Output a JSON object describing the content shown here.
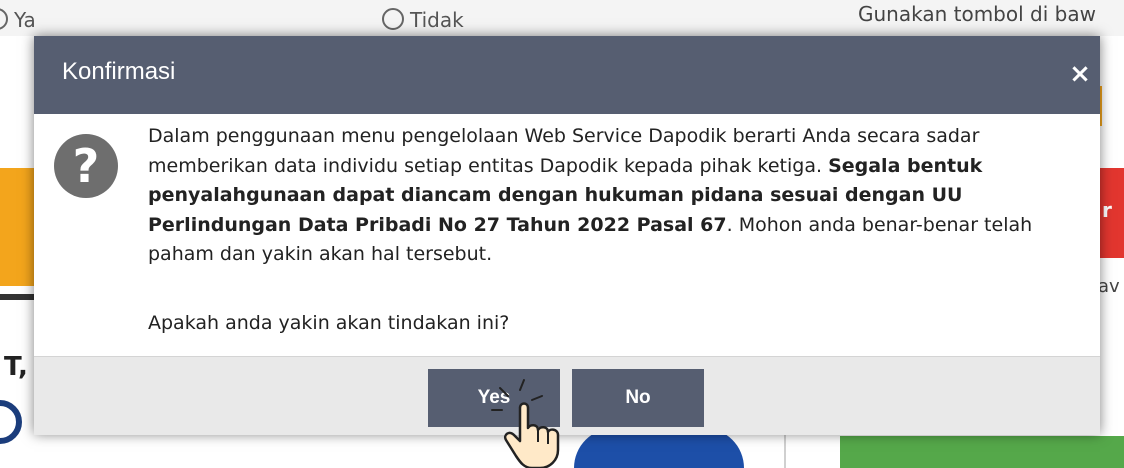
{
  "background": {
    "radio_yes": "Ya",
    "radio_no": "Tidak",
    "hint_text": "Gunakan tombol di baw",
    "left_letter": "T,",
    "right_letter": "r",
    "right_text": "av"
  },
  "dialog": {
    "title": "Konfirmasi",
    "close_icon": "×",
    "message_part1": "Dalam penggunaan menu pengelolaan Web Service Dapodik berarti Anda secara sadar memberikan data individu setiap entitas Dapodik kepada pihak ketiga. ",
    "message_bold": "Segala bentuk penyalahgunaan dapat diancam dengan hukuman pidana sesuai dengan UU Perlindungan Data Pribadi No 27 Tahun 2022 Pasal 67",
    "message_part2": ". Mohon anda benar-benar telah paham dan yakin akan hal tersebut.",
    "question": "Apakah anda yakin akan tindakan ini?",
    "yes_label": "Yes",
    "no_label": "No",
    "question_icon": "?"
  },
  "colors": {
    "header": "#565e71",
    "button": "#565e71",
    "footer": "#e9e9e9",
    "icon": "#6e6e6e"
  },
  "icons": {
    "close": "close-icon",
    "question": "question-circle-icon",
    "cursor": "hand-pointer-icon"
  }
}
